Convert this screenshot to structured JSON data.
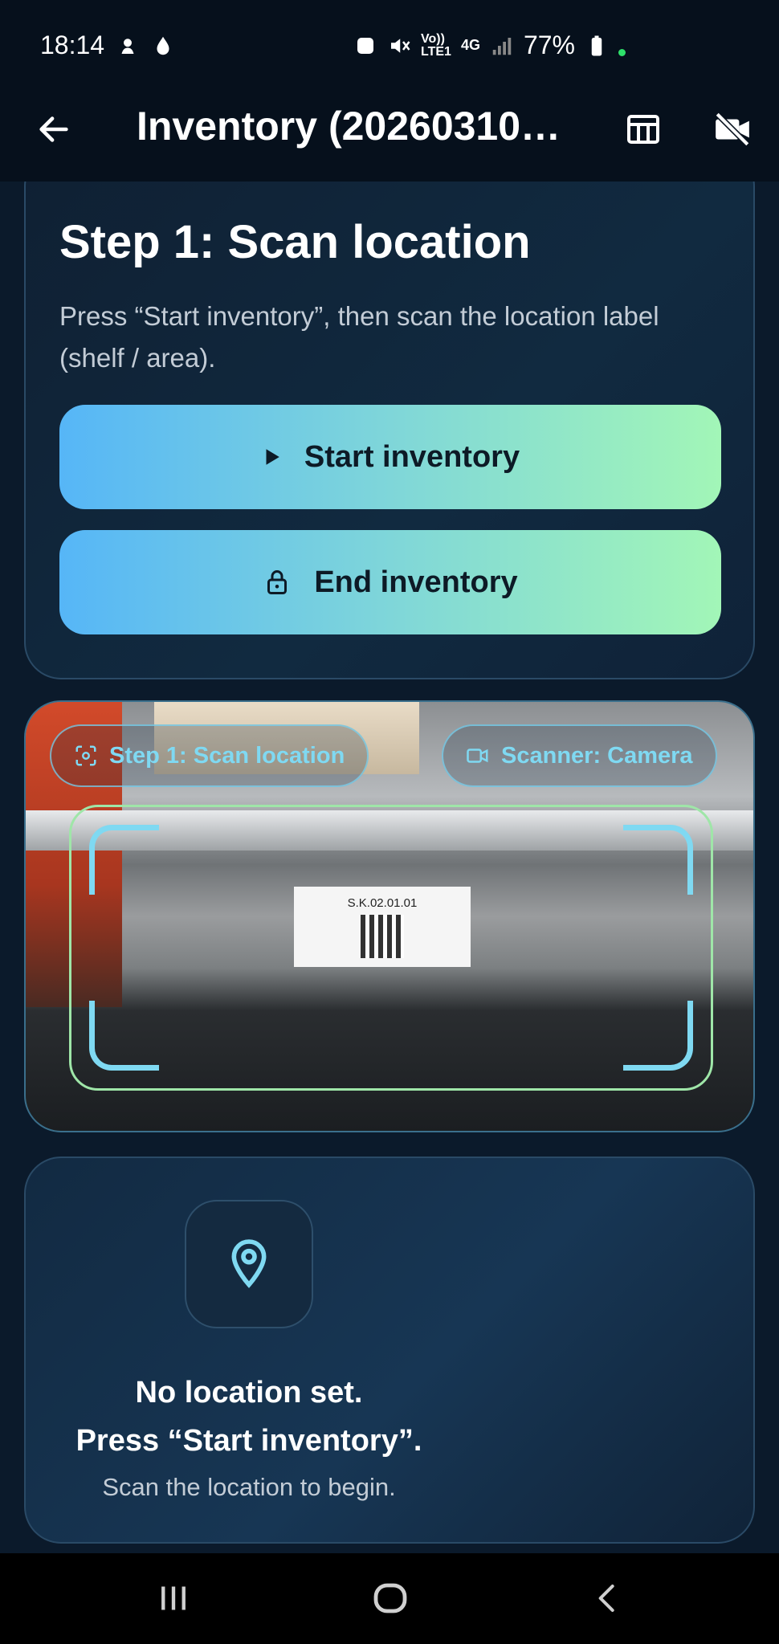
{
  "status_bar": {
    "time": "18:14",
    "network_volte": "Vo))",
    "network_lte": "LTE1",
    "network_gen": "4G",
    "battery": "77%"
  },
  "app_bar": {
    "title": "Inventory (20260310…",
    "back_icon": "arrow-left-icon",
    "table_icon": "table-icon",
    "camera_off_icon": "video-off-icon"
  },
  "step_card": {
    "title": "Step 1: Scan location",
    "description": "Press “Start inventory”, then scan the location label (shelf / area).",
    "start_button": "Start inventory",
    "end_button": "End inventory"
  },
  "camera": {
    "step_chip": "Step 1: Scan location",
    "scanner_chip": "Scanner: Camera",
    "shelf_label_text": "S.K.02.01.01"
  },
  "location_card": {
    "title": "No location set.\nPress “Start inventory”.",
    "subtitle": "Scan the location to begin."
  },
  "colors": {
    "accent_cyan": "#7fd9f2",
    "frame_green": "#9fe6a8",
    "button_gradient_start": "#56b6f7",
    "button_gradient_end": "#a2f6b7",
    "background": "#0b1a2b"
  }
}
